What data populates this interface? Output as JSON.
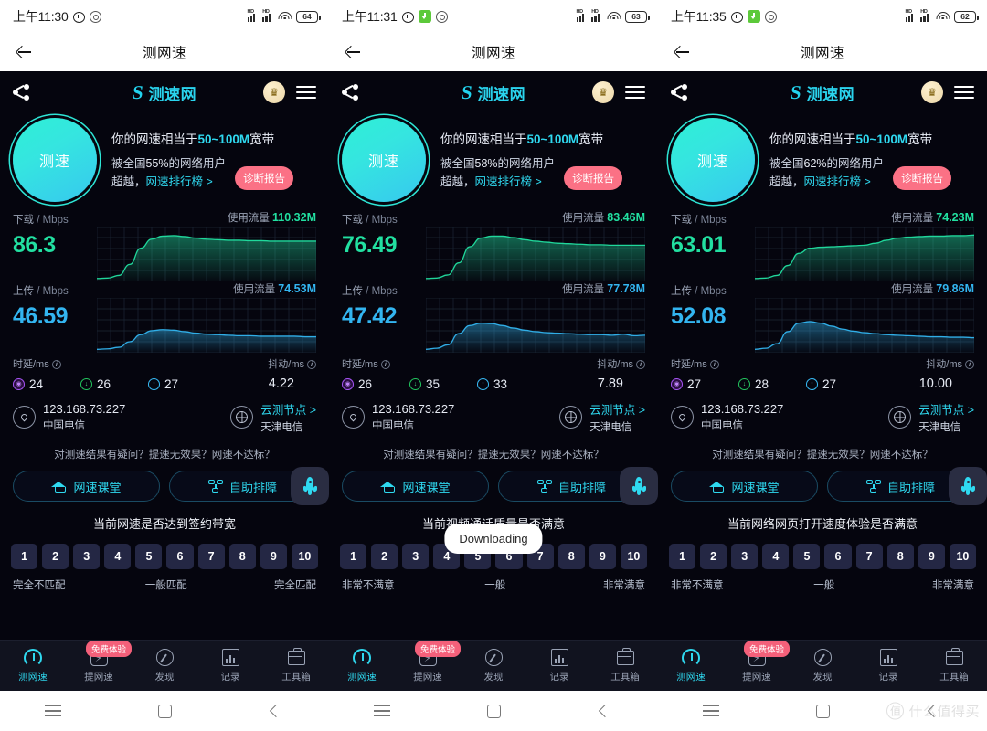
{
  "panels": [
    {
      "status": {
        "time": "上午11:30",
        "battery": "64",
        "has_download_icon": false
      },
      "appbar": {
        "title": "测网速"
      },
      "web": {
        "brand": "测速网",
        "dial_label": "测速",
        "hero_line1_pre": "你的网速相当于",
        "hero_line1_em": "50~100M",
        "hero_line1_post": "宽带",
        "hero_line2_pre": "被全国",
        "hero_percent": "55%",
        "hero_line2_post": "的网络用户",
        "hero_line3_pre": "超越，",
        "hero_rank": "网速排行榜 >",
        "report_label": "诊断报告",
        "download": {
          "caption": "下载",
          "unit": "/ Mbps",
          "value": "86.3",
          "used_label": "使用流量",
          "used_value": "110.32M"
        },
        "upload": {
          "caption": "上传",
          "unit": "/ Mbps",
          "value": "46.59",
          "used_label": "使用流量",
          "used_value": "74.53M"
        },
        "latency_label": "时延/ms",
        "jitter_label": "抖动/ms",
        "latency": {
          "idle": "24",
          "down": "26",
          "up": "27"
        },
        "jitter": "4.22",
        "ip": "123.168.73.227",
        "isp": "中国电信",
        "node_label": "云测节点 >",
        "node_name": "天津电信",
        "help_question": "对测速结果有疑问？提速无效果？网速不达标？",
        "help_btn1": "网速课堂",
        "help_btn2": "自助排障",
        "rating_question": "当前网速是否达到签约带宽",
        "scale": [
          "1",
          "2",
          "3",
          "4",
          "5",
          "6",
          "7",
          "8",
          "9",
          "10"
        ],
        "scale_low": "完全不匹配",
        "scale_mid": "一般匹配",
        "scale_high": "完全匹配",
        "tooltip": null
      },
      "appnav": [
        {
          "label": "测网速",
          "icon": "gauge-icon",
          "active": true,
          "badge": null
        },
        {
          "label": "提网速",
          "icon": "chip-boost-icon",
          "active": false,
          "badge": "免费体验"
        },
        {
          "label": "发现",
          "icon": "compass-icon",
          "active": false,
          "badge": null
        },
        {
          "label": "记录",
          "icon": "records-bars-icon",
          "active": false,
          "badge": null
        },
        {
          "label": "工具箱",
          "icon": "toolbox-icon",
          "active": false,
          "badge": null
        }
      ]
    },
    {
      "status": {
        "time": "上午11:31",
        "battery": "63",
        "has_download_icon": true
      },
      "appbar": {
        "title": "测网速"
      },
      "web": {
        "brand": "测速网",
        "dial_label": "测速",
        "hero_line1_pre": "你的网速相当于",
        "hero_line1_em": "50~100M",
        "hero_line1_post": "宽带",
        "hero_line2_pre": "被全国",
        "hero_percent": "58%",
        "hero_line2_post": "的网络用户",
        "hero_line3_pre": "超越，",
        "hero_rank": "网速排行榜 >",
        "report_label": "诊断报告",
        "download": {
          "caption": "下载",
          "unit": "/ Mbps",
          "value": "76.49",
          "used_label": "使用流量",
          "used_value": "83.46M"
        },
        "upload": {
          "caption": "上传",
          "unit": "/ Mbps",
          "value": "47.42",
          "used_label": "使用流量",
          "used_value": "77.78M"
        },
        "latency_label": "时延/ms",
        "jitter_label": "抖动/ms",
        "latency": {
          "idle": "26",
          "down": "35",
          "up": "33"
        },
        "jitter": "7.89",
        "ip": "123.168.73.227",
        "isp": "中国电信",
        "node_label": "云测节点 >",
        "node_name": "天津电信",
        "help_question": "对测速结果有疑问？提速无效果？网速不达标？",
        "help_btn1": "网速课堂",
        "help_btn2": "自助排障",
        "rating_question": "当前视频通话质量是否满意",
        "scale": [
          "1",
          "2",
          "3",
          "4",
          "5",
          "6",
          "7",
          "8",
          "9",
          "10"
        ],
        "scale_low": "非常不满意",
        "scale_mid": "一般",
        "scale_high": "非常满意",
        "tooltip": "Downloading"
      },
      "appnav": [
        {
          "label": "测网速",
          "icon": "gauge-icon",
          "active": true,
          "badge": null
        },
        {
          "label": "提网速",
          "icon": "chip-boost-icon",
          "active": false,
          "badge": "免费体验"
        },
        {
          "label": "发现",
          "icon": "compass-icon",
          "active": false,
          "badge": null
        },
        {
          "label": "记录",
          "icon": "records-bars-icon",
          "active": false,
          "badge": null
        },
        {
          "label": "工具箱",
          "icon": "toolbox-icon",
          "active": false,
          "badge": null
        }
      ]
    },
    {
      "status": {
        "time": "上午11:35",
        "battery": "62",
        "has_download_icon": true
      },
      "appbar": {
        "title": "测网速"
      },
      "web": {
        "brand": "测速网",
        "dial_label": "测速",
        "hero_line1_pre": "你的网速相当于",
        "hero_line1_em": "50~100M",
        "hero_line1_post": "宽带",
        "hero_line2_pre": "被全国",
        "hero_percent": "62%",
        "hero_line2_post": "的网络用户",
        "hero_line3_pre": "超越，",
        "hero_rank": "网速排行榜 >",
        "report_label": "诊断报告",
        "download": {
          "caption": "下载",
          "unit": "/ Mbps",
          "value": "63.01",
          "used_label": "使用流量",
          "used_value": "74.23M"
        },
        "upload": {
          "caption": "上传",
          "unit": "/ Mbps",
          "value": "52.08",
          "used_label": "使用流量",
          "used_value": "79.86M"
        },
        "latency_label": "时延/ms",
        "jitter_label": "抖动/ms",
        "latency": {
          "idle": "27",
          "down": "28",
          "up": "27"
        },
        "jitter": "10.00",
        "ip": "123.168.73.227",
        "isp": "中国电信",
        "node_label": "云测节点 >",
        "node_name": "天津电信",
        "help_question": "对测速结果有疑问？提速无效果？网速不达标？",
        "help_btn1": "网速课堂",
        "help_btn2": "自助排障",
        "rating_question": "当前网络网页打开速度体验是否满意",
        "scale": [
          "1",
          "2",
          "3",
          "4",
          "5",
          "6",
          "7",
          "8",
          "9",
          "10"
        ],
        "scale_low": "非常不满意",
        "scale_mid": "一般",
        "scale_high": "非常满意",
        "tooltip": null
      },
      "appnav": [
        {
          "label": "测网速",
          "icon": "gauge-icon",
          "active": true,
          "badge": null
        },
        {
          "label": "提网速",
          "icon": "chip-boost-icon",
          "active": false,
          "badge": "免费体验"
        },
        {
          "label": "发现",
          "icon": "compass-icon",
          "active": false,
          "badge": null
        },
        {
          "label": "记录",
          "icon": "records-bars-icon",
          "active": false,
          "badge": null
        },
        {
          "label": "工具箱",
          "icon": "toolbox-icon",
          "active": false,
          "badge": null
        }
      ]
    }
  ],
  "watermark": {
    "text": "什么值得买",
    "logo_char": "值"
  },
  "colors": {
    "download_green": "#22e0a1",
    "upload_blue": "#33b5f0",
    "accent_cyan": "#2fd9f0",
    "report_pink": "#fb7185",
    "badge_pink": "#f4607a",
    "web_bg": "#05050e",
    "nav_bg": "#11131f"
  },
  "chart_data": [
    {
      "type": "area",
      "title": "下载 / Mbps",
      "panel": 1,
      "series_name": "download",
      "x": [
        0,
        1,
        2,
        3,
        4,
        5,
        6,
        7,
        8,
        9,
        10,
        11,
        12,
        13,
        14,
        15,
        16,
        17,
        18,
        19,
        20
      ],
      "values": [
        2,
        3,
        8,
        30,
        62,
        80,
        86,
        87,
        85,
        82,
        80,
        79,
        78,
        78,
        77,
        77,
        76,
        76,
        76,
        76,
        76
      ],
      "ylim": [
        0,
        100
      ],
      "grid": true,
      "color": "#22e0a1"
    },
    {
      "type": "area",
      "title": "上传 / Mbps",
      "panel": 1,
      "series_name": "upload",
      "x": [
        0,
        1,
        2,
        3,
        4,
        5,
        6,
        7,
        8,
        9,
        10,
        11,
        12,
        13,
        14,
        15,
        16,
        17,
        18,
        19,
        20
      ],
      "values": [
        3,
        4,
        7,
        18,
        32,
        40,
        42,
        41,
        38,
        35,
        33,
        32,
        31,
        30,
        30,
        29,
        29,
        29,
        29,
        28,
        28
      ],
      "ylim": [
        0,
        100
      ],
      "grid": true,
      "color": "#33b5f0"
    },
    {
      "type": "area",
      "title": "下载 / Mbps",
      "panel": 2,
      "series_name": "download",
      "x": [
        0,
        1,
        2,
        3,
        4,
        5,
        6,
        7,
        8,
        9,
        10,
        11,
        12,
        13,
        14,
        15,
        16,
        17,
        18,
        19,
        20
      ],
      "values": [
        2,
        3,
        9,
        33,
        65,
        82,
        86,
        86,
        83,
        79,
        76,
        74,
        72,
        71,
        70,
        69,
        69,
        68,
        68,
        68,
        68
      ],
      "ylim": [
        0,
        100
      ],
      "grid": true,
      "color": "#22e0a1"
    },
    {
      "type": "area",
      "title": "上传 / Mbps",
      "panel": 2,
      "series_name": "upload",
      "x": [
        0,
        1,
        2,
        3,
        4,
        5,
        6,
        7,
        8,
        9,
        10,
        11,
        12,
        13,
        14,
        15,
        16,
        17,
        18,
        19,
        20
      ],
      "values": [
        3,
        5,
        12,
        34,
        50,
        55,
        54,
        50,
        45,
        41,
        38,
        36,
        35,
        34,
        33,
        32,
        32,
        31,
        33,
        30,
        31
      ],
      "ylim": [
        0,
        100
      ],
      "grid": true,
      "color": "#33b5f0"
    },
    {
      "type": "area",
      "title": "下载 / Mbps",
      "panel": 3,
      "series_name": "download",
      "x": [
        0,
        1,
        2,
        3,
        4,
        5,
        6,
        7,
        8,
        9,
        10,
        11,
        12,
        13,
        14,
        15,
        16,
        17,
        18,
        19,
        20
      ],
      "values": [
        2,
        3,
        8,
        28,
        52,
        62,
        64,
        65,
        66,
        67,
        68,
        72,
        78,
        82,
        84,
        85,
        86,
        86,
        87,
        87,
        88
      ],
      "ylim": [
        0,
        100
      ],
      "grid": true,
      "color": "#22e0a1"
    },
    {
      "type": "area",
      "title": "上传 / Mbps",
      "panel": 3,
      "series_name": "upload",
      "x": [
        0,
        1,
        2,
        3,
        4,
        5,
        6,
        7,
        8,
        9,
        10,
        11,
        12,
        13,
        14,
        15,
        16,
        17,
        18,
        19,
        20
      ],
      "values": [
        3,
        5,
        14,
        38,
        55,
        58,
        55,
        49,
        43,
        39,
        36,
        34,
        32,
        31,
        30,
        29,
        28,
        28,
        27,
        27,
        26
      ],
      "ylim": [
        0,
        100
      ],
      "grid": true,
      "color": "#33b5f0"
    }
  ]
}
